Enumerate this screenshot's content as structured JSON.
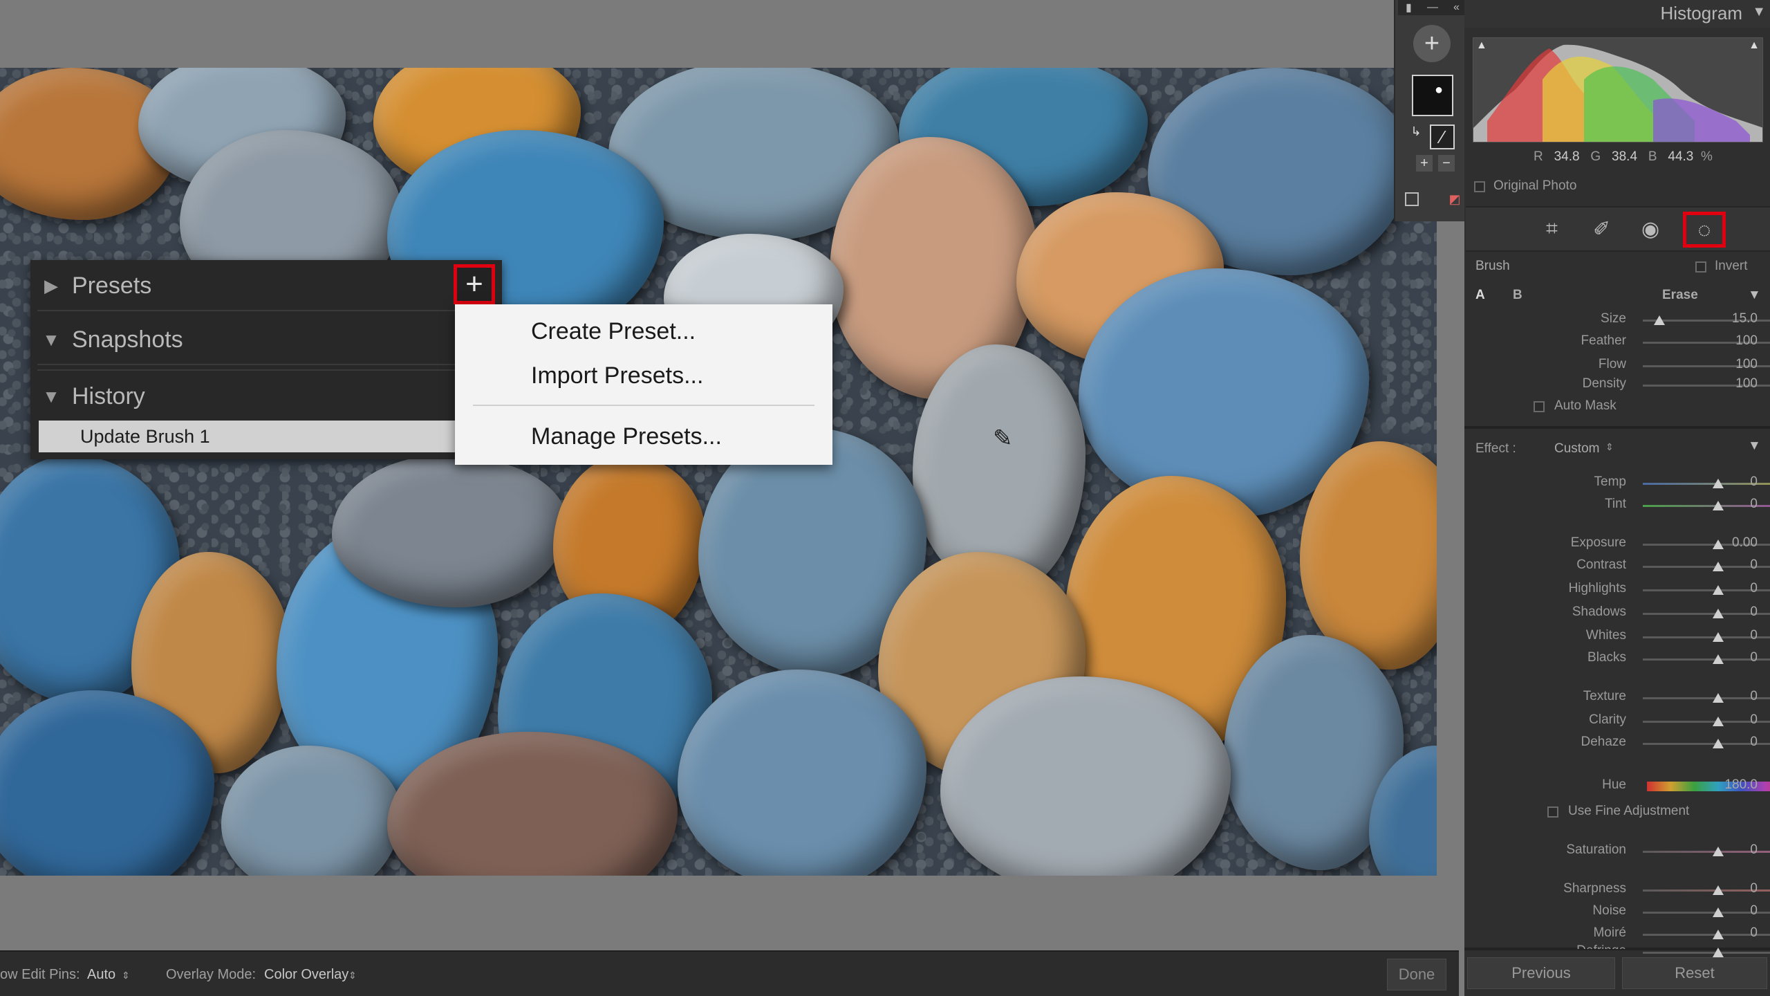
{
  "left_panel": {
    "presets_label": "Presets",
    "snapshots_label": "Snapshots",
    "history_label": "History",
    "history_items": [
      "Update Brush 1"
    ]
  },
  "dropdown": {
    "create_preset": "Create Preset...",
    "import_presets": "Import Presets...",
    "manage_presets": "Manage Presets..."
  },
  "histogram": {
    "title": "Histogram",
    "r_label": "R",
    "r_value": "34.8",
    "g_label": "G",
    "g_value": "38.4",
    "b_label": "B",
    "b_value": "44.3",
    "unit": "%",
    "original_photo": "Original Photo"
  },
  "brush": {
    "label": "Brush",
    "invert": "Invert",
    "a": "A",
    "b": "B",
    "erase": "Erase",
    "size_label": "Size",
    "size_value": "15.0",
    "feather_label": "Feather",
    "feather_value": "100",
    "flow_label": "Flow",
    "flow_value": "100",
    "density_label": "Density",
    "density_value": "100",
    "auto_mask": "Auto Mask"
  },
  "effect": {
    "label": "Effect :",
    "preset": "Custom",
    "sliders": [
      {
        "label": "Temp",
        "value": "0"
      },
      {
        "label": "Tint",
        "value": "0"
      },
      {
        "label": "Exposure",
        "value": "0.00"
      },
      {
        "label": "Contrast",
        "value": "0"
      },
      {
        "label": "Highlights",
        "value": "0"
      },
      {
        "label": "Shadows",
        "value": "0"
      },
      {
        "label": "Whites",
        "value": "0"
      },
      {
        "label": "Blacks",
        "value": "0"
      },
      {
        "label": "Texture",
        "value": "0"
      },
      {
        "label": "Clarity",
        "value": "0"
      },
      {
        "label": "Dehaze",
        "value": "0"
      },
      {
        "label": "Hue",
        "value": "180.0"
      },
      {
        "label": "Saturation",
        "value": "0"
      },
      {
        "label": "Sharpness",
        "value": "0"
      },
      {
        "label": "Noise",
        "value": "0"
      },
      {
        "label": "Moiré",
        "value": "0"
      },
      {
        "label": "Defringe",
        "value": ""
      }
    ],
    "use_fine_adjustment": "Use Fine Adjustment"
  },
  "bottom_bar": {
    "edit_pins_label": "ow Edit Pins:",
    "edit_pins_value": "Auto",
    "overlay_label": "Overlay Mode:",
    "overlay_value": "Color Overlay",
    "done": "Done",
    "previous": "Previous",
    "reset": "Reset"
  },
  "colors": {
    "highlight_red": "#e00010",
    "panel_dark": "#2f2f2f"
  }
}
